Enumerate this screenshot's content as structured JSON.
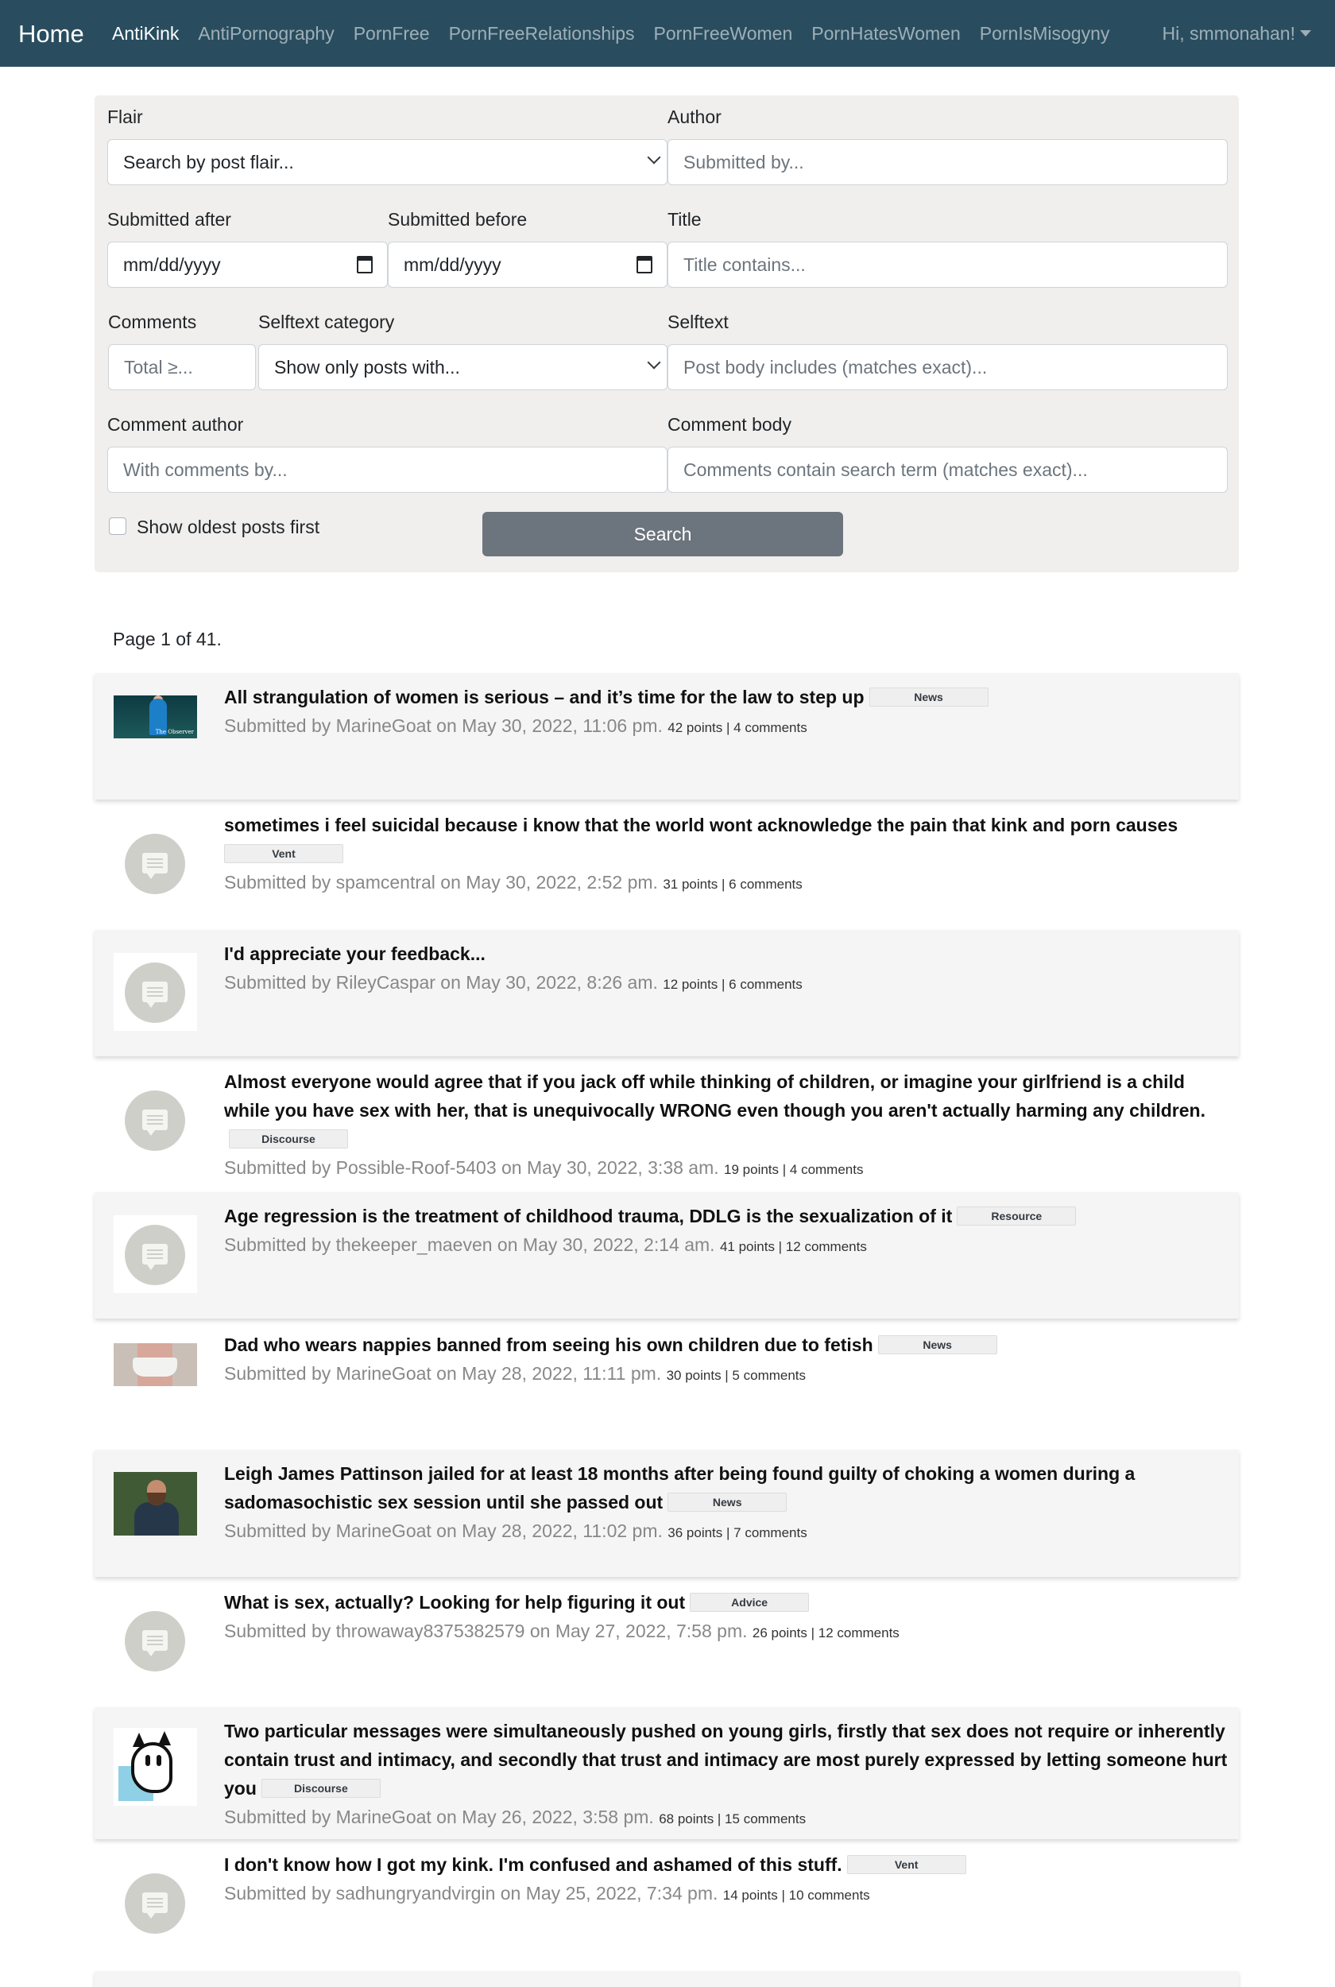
{
  "navbar": {
    "brand": "Home",
    "links": [
      {
        "label": "AntiKink",
        "active": true
      },
      {
        "label": "AntiPornography",
        "active": false
      },
      {
        "label": "PornFree",
        "active": false
      },
      {
        "label": "PornFreeRelationships",
        "active": false
      },
      {
        "label": "PornFreeWomen",
        "active": false
      },
      {
        "label": "PornHatesWomen",
        "active": false
      },
      {
        "label": "PornIsMisogyny",
        "active": false
      }
    ],
    "user_menu": "Hi, smmonahan!"
  },
  "filters": {
    "flair_label": "Flair",
    "flair_placeholder": "Search by post flair...",
    "author_label": "Author",
    "author_placeholder": "Submitted by...",
    "after_label": "Submitted after",
    "after_value": "mm/dd/yyyy",
    "before_label": "Submitted before",
    "before_value": "mm/dd/yyyy",
    "title_label": "Title",
    "title_placeholder": "Title contains...",
    "comments_label": "Comments",
    "comments_placeholder": "Total ≥...",
    "selftext_cat_label": "Selftext category",
    "selftext_cat_placeholder": "Show only posts with...",
    "selftext_label": "Selftext",
    "selftext_placeholder": "Post body includes (matches exact)...",
    "comment_author_label": "Comment author",
    "comment_author_placeholder": "With comments by...",
    "comment_body_label": "Comment body",
    "comment_body_placeholder": "Comments contain search term (matches exact)...",
    "oldest_first_label": "Show oldest posts first",
    "search_button": "Search"
  },
  "page_info": "Page 1 of 41.",
  "posts": [
    {
      "title": "All strangulation of women is serious – and it’s time for the law to step up",
      "flair": "News",
      "submitted": "Submitted by MarineGoat on May 30, 2022, 11:06 pm.",
      "stats": "42 points | 4 comments",
      "thumb": "photo-observer-icon"
    },
    {
      "title": "sometimes i feel suicidal because i know that the world wont acknowledge the pain that kink and porn causes",
      "flair": "Vent",
      "submitted": "Submitted by spamcentral on May 30, 2022, 2:52 pm.",
      "stats": "31 points | 6 comments",
      "thumb": "self-post-icon"
    },
    {
      "title": "I'd appreciate your feedback...",
      "flair": "",
      "submitted": "Submitted by RileyCaspar on May 30, 2022, 8:26 am.",
      "stats": "12 points | 6 comments",
      "thumb": "self-post-icon"
    },
    {
      "title": "Almost everyone would agree that if you jack off while thinking of children, or imagine your girlfriend is a child while you have sex with her, that is unequivocally WRONG even though you aren't actually harming any children.",
      "flair": "Discourse",
      "submitted": "Submitted by Possible-Roof-5403 on May 30, 2022, 3:38 am.",
      "stats": "19 points | 4 comments",
      "thumb": "self-post-icon"
    },
    {
      "title": "Age regression is the treatment of childhood trauma, DDLG is the sexualization of it",
      "flair": "Resource",
      "submitted": "Submitted by thekeeper_maeven on May 30, 2022, 2:14 am.",
      "stats": "41 points | 12 comments",
      "thumb": "self-post-icon"
    },
    {
      "title": "Dad who wears nappies banned from seeing his own children due to fetish",
      "flair": "News",
      "submitted": "Submitted by MarineGoat on May 28, 2022, 11:11 pm.",
      "stats": "30 points | 5 comments",
      "thumb": "photo-nappy-icon"
    },
    {
      "title": "Leigh James Pattinson jailed for at least 18 months after being found guilty of choking a women during a sadomasochistic sex session until she passed out",
      "flair": "News",
      "submitted": "Submitted by MarineGoat on May 28, 2022, 11:02 pm.",
      "stats": "36 points | 7 comments",
      "thumb": "photo-man-icon"
    },
    {
      "title": "What is sex, actually? Looking for help figuring it out",
      "flair": "Advice",
      "submitted": "Submitted by throwaway8375382579 on May 27, 2022, 7:58 pm.",
      "stats": "26 points | 12 comments",
      "thumb": "self-post-icon"
    },
    {
      "title": "Two particular messages were simultaneously pushed on young girls, firstly that sex does not require or inherently contain trust and intimacy, and secondly that trust and intimacy are most purely expressed by letting someone hurt you",
      "flair": "Discourse",
      "submitted": "Submitted by MarineGoat on May 26, 2022, 3:58 pm.",
      "stats": "68 points | 15 comments",
      "thumb": "photo-cat-icon"
    },
    {
      "title": "I don't know how I got my kink. I'm confused and ashamed of this stuff.",
      "flair": "Vent",
      "submitted": "Submitted by sadhungryandvirgin on May 25, 2022, 7:34 pm.",
      "stats": "14 points | 10 comments",
      "thumb": "self-post-icon"
    }
  ]
}
